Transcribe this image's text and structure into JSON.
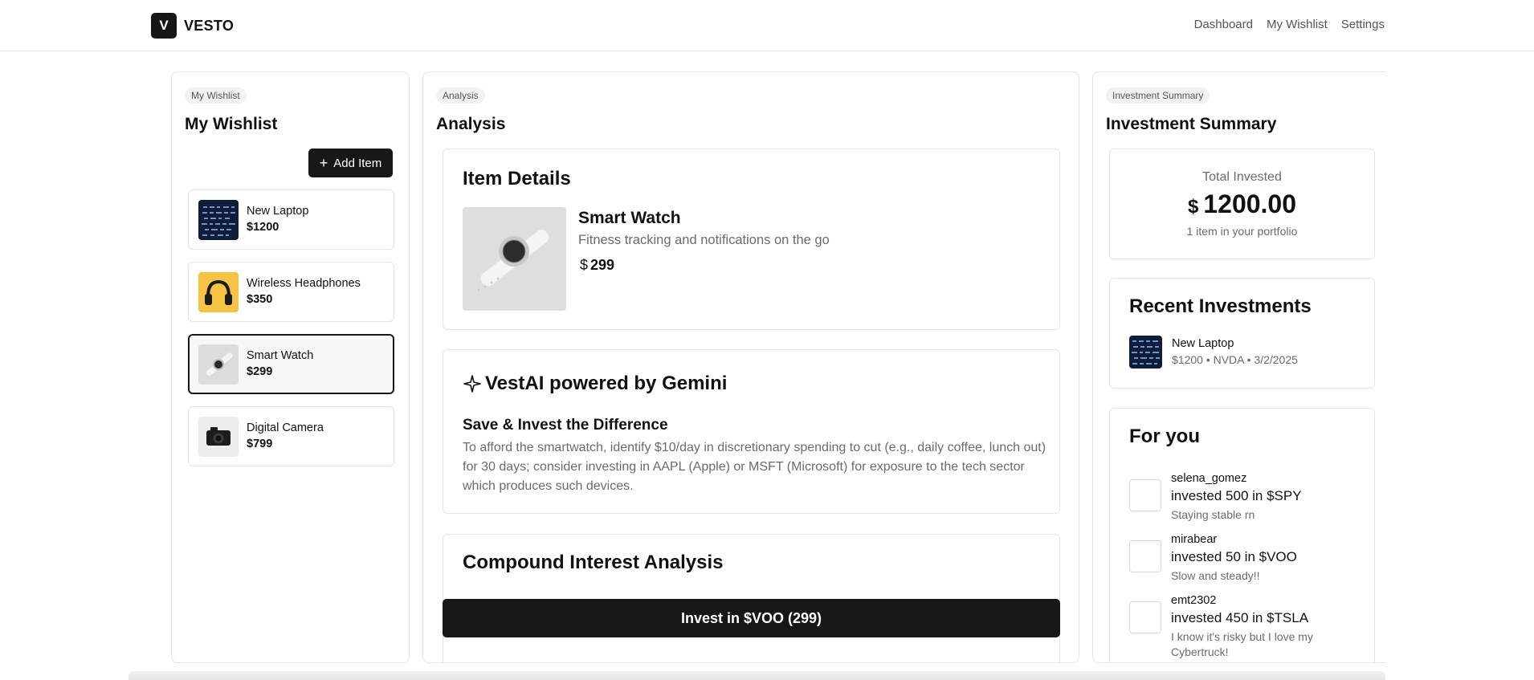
{
  "brand": {
    "logo_letter": "V",
    "name": "VESTO"
  },
  "nav": {
    "links": [
      "Dashboard",
      "My Wishlist",
      "Settings"
    ]
  },
  "wishlist": {
    "pill": "My Wishlist",
    "title": "My Wishlist",
    "add_label": "Add Item",
    "items": [
      {
        "name": "New Laptop",
        "price": "$1200",
        "icon": "laptop-image"
      },
      {
        "name": "Wireless Headphones",
        "price": "$350",
        "icon": "headphones-image"
      },
      {
        "name": "Smart Watch",
        "price": "$299",
        "icon": "smartwatch-image",
        "selected": true
      },
      {
        "name": "Digital Camera",
        "price": "$799",
        "icon": "camera-image"
      }
    ]
  },
  "analysis": {
    "pill": "Analysis",
    "title": "Analysis",
    "item_details": {
      "heading": "Item Details",
      "name": "Smart Watch",
      "description": "Fitness tracking and notifications on the go",
      "currency_symbol": "$",
      "price": "299"
    },
    "ai": {
      "heading": "VestAI powered by Gemini",
      "subheading": "Save & Invest the Difference",
      "body": "To afford the smartwatch, identify $10/day in discretionary spending to cut (e.g., daily coffee, lunch out) for 30 days; consider investing in AAPL (Apple) or MSFT (Microsoft) for exposure to the tech sector which produces such devices."
    },
    "compound": {
      "heading": "Compound Interest Analysis"
    },
    "invest_button": "Invest in $VOO (299)"
  },
  "summary": {
    "pill": "Investment Summary",
    "title": "Investment Summary",
    "total_label": "Total Invested",
    "currency_symbol": "$",
    "total_value": "1200.00",
    "total_note": "1 item in your portfolio",
    "recent": {
      "heading": "Recent Investments",
      "items": [
        {
          "name": "New Laptop",
          "meta": "$1200 • NVDA • 3/2/2025"
        }
      ]
    },
    "for_you": {
      "heading": "For you",
      "feed": [
        {
          "user": "selena_gomez",
          "action": "invested 500 in $SPY",
          "note": "Staying stable rn"
        },
        {
          "user": "mirabear",
          "action": "invested 50 in $VOO",
          "note": "Slow and steady!!"
        },
        {
          "user": "emt2302",
          "action": "invested 450 in $TSLA",
          "note": "I know it's risky but I love my Cybertruck!"
        }
      ]
    }
  },
  "colors": {
    "primary": "#171717",
    "muted_text": "#6b6b6b",
    "border": "#e5e5e5"
  }
}
